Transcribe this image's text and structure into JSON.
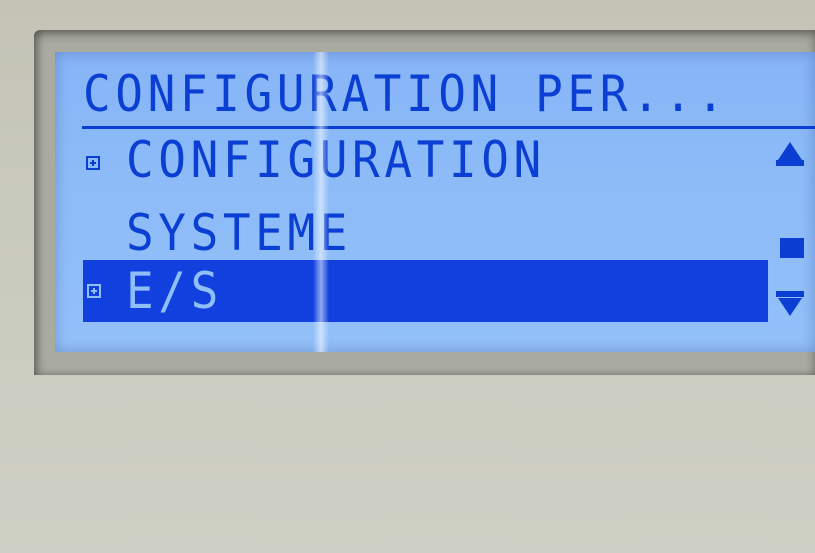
{
  "display": {
    "title": "CONFIGURATION PER...",
    "menu_items": [
      {
        "label_line1": "CONFIGURATION",
        "label_line2": "SYSTEME",
        "icon": "plus-box-icon",
        "selected": false
      },
      {
        "label": "E/S",
        "icon": "plus-box-icon",
        "selected": true
      }
    ],
    "scrollbar": {
      "up_icon": "triangle-up-icon",
      "thumb_icon": "square-thumb-icon",
      "down_icon": "triangle-down-icon"
    }
  },
  "colors": {
    "lcd_background": "#8cbbf8",
    "lcd_text": "#0b3fd4",
    "selection_background": "#1140df",
    "selection_text": "#8fbff8",
    "bezel": "#c9cabe"
  }
}
